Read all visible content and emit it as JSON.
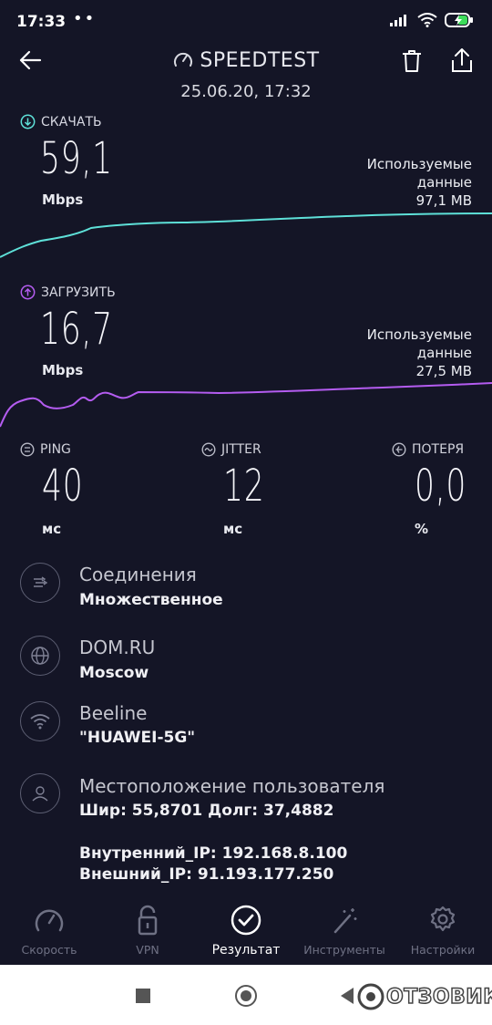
{
  "status": {
    "time": "17:33",
    "dots": "••"
  },
  "header": {
    "title": "SPEEDTEST",
    "datetime": "25.06.20, 17:32"
  },
  "download": {
    "label": "СКАЧАТЬ",
    "value": "59,1",
    "unit": "Mbps",
    "used_line1": "Используемые",
    "used_line2": "данные",
    "used_value": "97,1 MB",
    "color": "#5ee0d8"
  },
  "upload": {
    "label": "ЗАГРУЗИТЬ",
    "value": "16,7",
    "unit": "Mbps",
    "used_line1": "Используемые",
    "used_line2": "данные",
    "used_value": "27,5 MB",
    "color": "#b45cf0"
  },
  "metrics": {
    "ping": {
      "label": "PING",
      "value": "40",
      "unit": "мс"
    },
    "jitter": {
      "label": "JITTER",
      "value": "12",
      "unit": "мс"
    },
    "loss": {
      "label": "ПОТЕРЯ",
      "value": "0,0",
      "unit": "%"
    }
  },
  "info": {
    "connections": {
      "title": "Соединения",
      "sub": "Множественное"
    },
    "provider": {
      "title": "DOM.RU",
      "sub": "Moscow"
    },
    "network": {
      "title": "Beeline",
      "sub": "\"HUAWEI-5G\""
    },
    "location": {
      "title": "Местоположение пользователя",
      "sub": "Шир: 55,8701 Долг: 37,4882"
    },
    "internal_ip": "Внутренний_IP: 192.168.8.100",
    "external_ip": "Внешний_IP: 91.193.177.250"
  },
  "tabs": [
    {
      "label": "Скорость"
    },
    {
      "label": "VPN"
    },
    {
      "label": "Результат"
    },
    {
      "label": "Инструменты"
    },
    {
      "label": "Настройки"
    }
  ],
  "watermark": "ОТЗОВИК"
}
